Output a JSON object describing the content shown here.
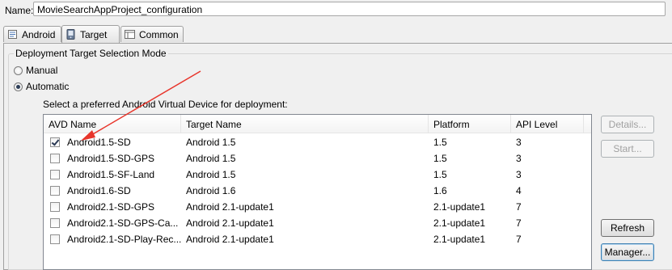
{
  "name_row": {
    "label": "Name:",
    "value": "MovieSearchAppProject_configuration"
  },
  "tabs": [
    {
      "label": "Android",
      "icon": "android-tab-icon",
      "active": false
    },
    {
      "label": "Target",
      "icon": "target-tab-icon",
      "active": true
    },
    {
      "label": "Common",
      "icon": "common-tab-icon",
      "active": false
    }
  ],
  "mode_group": {
    "title": "Deployment Target Selection Mode",
    "manual_label": "Manual",
    "automatic_label": "Automatic",
    "selected": "Automatic"
  },
  "avd": {
    "prompt": "Select a preferred Android Virtual Device for deployment:",
    "columns": [
      "AVD Name",
      "Target Name",
      "Platform",
      "API Level"
    ],
    "rows": [
      {
        "name": "Android1.5-SD",
        "target": "Android 1.5",
        "platform": "1.5",
        "api": "3",
        "checked": true
      },
      {
        "name": "Android1.5-SD-GPS",
        "target": "Android 1.5",
        "platform": "1.5",
        "api": "3",
        "checked": false
      },
      {
        "name": "Android1.5-SF-Land",
        "target": "Android 1.5",
        "platform": "1.5",
        "api": "3",
        "checked": false
      },
      {
        "name": "Android1.6-SD",
        "target": "Android 1.6",
        "platform": "1.6",
        "api": "4",
        "checked": false
      },
      {
        "name": "Android2.1-SD-GPS",
        "target": "Android 2.1-update1",
        "platform": "2.1-update1",
        "api": "7",
        "checked": false
      },
      {
        "name": "Android2.1-SD-GPS-Ca...",
        "target": "Android 2.1-update1",
        "platform": "2.1-update1",
        "api": "7",
        "checked": false
      },
      {
        "name": "Android2.1-SD-Play-Rec...",
        "target": "Android 2.1-update1",
        "platform": "2.1-update1",
        "api": "7",
        "checked": false
      }
    ]
  },
  "buttons": {
    "details": "Details...",
    "start": "Start...",
    "refresh": "Refresh",
    "manager": "Manager..."
  },
  "colors": {
    "annotation_arrow": "#e8352b",
    "selection_dot": "#2e3e58"
  }
}
